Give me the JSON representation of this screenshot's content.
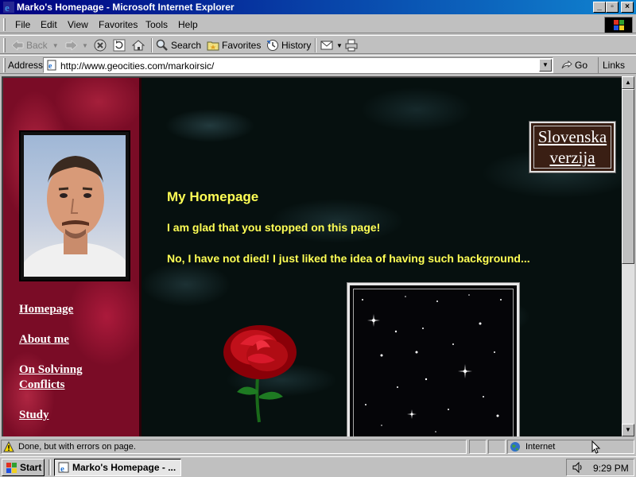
{
  "window": {
    "title": "Marko's Homepage - Microsoft Internet Explorer"
  },
  "menu": {
    "items": [
      "File",
      "Edit",
      "View",
      "Favorites",
      "Tools",
      "Help"
    ]
  },
  "toolbar": {
    "back": "Back",
    "forward": "",
    "search": "Search",
    "favorites": "Favorites",
    "history": "History"
  },
  "address": {
    "label": "Address",
    "url": "http://www.geocities.com/markoirsic/",
    "go": "Go",
    "links": "Links"
  },
  "page": {
    "language_link": "Slovenska verzija",
    "heading": "My Homepage",
    "line1": "I am glad that you stopped on this page!",
    "line2": "No, I have not died! I just liked the idea of having such background...",
    "nav": [
      "Homepage",
      "About me",
      "On Solvinng Conflicts",
      "Study"
    ]
  },
  "status": {
    "message": "Done, but with errors on page.",
    "zone": "Internet"
  },
  "taskbar": {
    "start": "Start",
    "task": "Marko's Homepage - ...",
    "clock": "9:29 PM"
  }
}
